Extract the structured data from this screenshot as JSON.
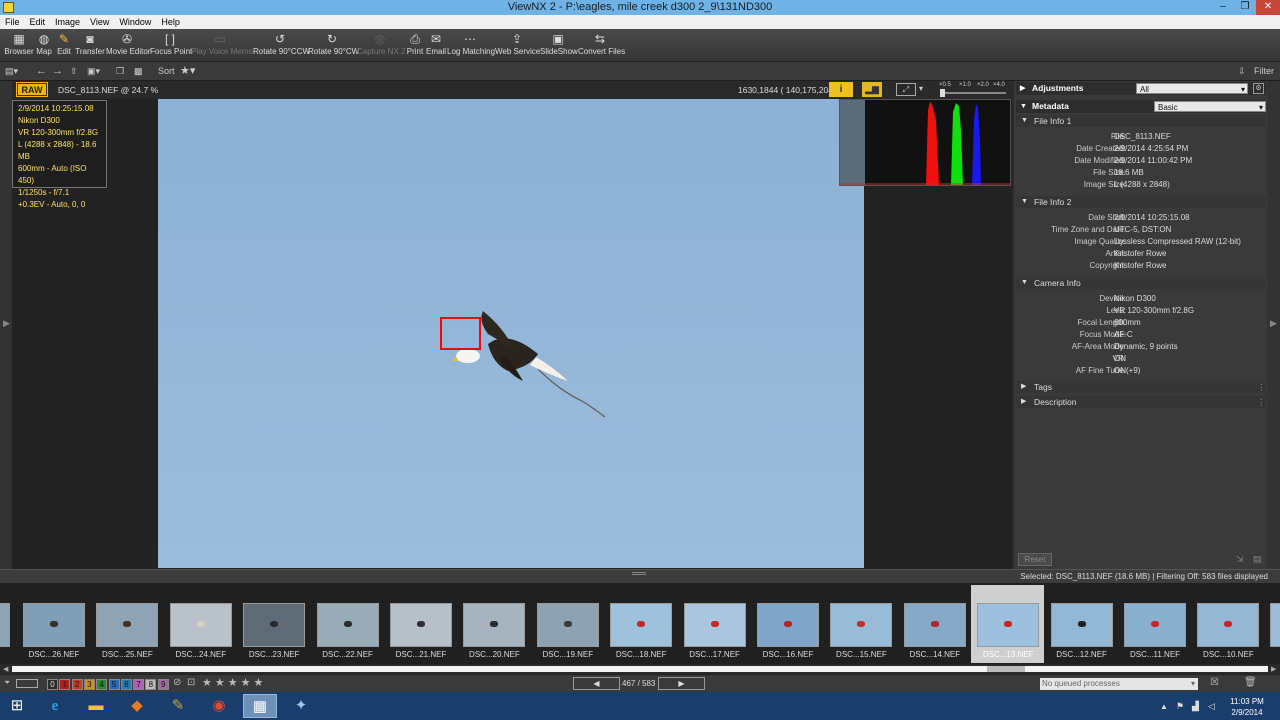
{
  "window": {
    "title": "ViewNX 2 - P:\\eagles, mile creek d300 2_9\\131ND300",
    "min": "–",
    "max": "❐",
    "close": "✕"
  },
  "menu": [
    "File",
    "Edit",
    "Image",
    "View",
    "Window",
    "Help"
  ],
  "toolbar": [
    {
      "label": "Browser",
      "icon": "grid-icon",
      "glyph": "▦",
      "enabled": true
    },
    {
      "label": "Map",
      "icon": "globe-icon",
      "glyph": "◍",
      "enabled": true
    },
    {
      "label": "Edit",
      "icon": "pencil-icon",
      "glyph": "✎",
      "enabled": true
    },
    {
      "label": "Transfer",
      "icon": "camera-icon",
      "glyph": "◙",
      "enabled": true
    },
    {
      "label": "Movie Editor",
      "icon": "film-reel-icon",
      "glyph": "✇",
      "enabled": true
    },
    {
      "label": "Focus Point",
      "icon": "focus-bracket-icon",
      "glyph": "[ ]",
      "enabled": true
    },
    {
      "label": "Play Voice Memo",
      "icon": "speaker-icon",
      "glyph": "▭",
      "enabled": false
    },
    {
      "label": "Rotate 90°CCW",
      "icon": "rotate-ccw-icon",
      "glyph": "↺",
      "enabled": true
    },
    {
      "label": "Rotate 90°CW",
      "icon": "rotate-cw-icon",
      "glyph": "↻",
      "enabled": true
    },
    {
      "label": "Capture NX 2",
      "icon": "capture-nx-icon",
      "glyph": "◎",
      "enabled": false
    },
    {
      "label": "Print",
      "icon": "printer-icon",
      "glyph": "⎙",
      "enabled": true
    },
    {
      "label": "Email",
      "icon": "envelope-icon",
      "glyph": "✉",
      "enabled": true
    },
    {
      "label": "Log Matching",
      "icon": "log-matching-icon",
      "glyph": "⋯",
      "enabled": true
    },
    {
      "label": "Web Service",
      "icon": "web-service-icon",
      "glyph": "⇪",
      "enabled": true
    },
    {
      "label": "SlideShow",
      "icon": "slideshow-icon",
      "glyph": "▣",
      "enabled": true
    },
    {
      "label": "Convert Files",
      "icon": "convert-files-icon",
      "glyph": "⇆",
      "enabled": true
    }
  ],
  "toolbar2": {
    "sort_label": "Sort",
    "filter_label": "Filter"
  },
  "viewer": {
    "badge": "RAW",
    "filename": "DSC_8113.NEF @ 24.7 %",
    "coords": "1630,1844 ( 140,175,204 )",
    "zoom_levels": [
      "×0.5",
      "×1.0",
      "×2.0",
      "×4.0"
    ],
    "exif": [
      "2/9/2014 10:25:15.08",
      "Nikon D300",
      "VR 120-300mm f/2.8G",
      "L (4288 x 2848) - 18.6 MB",
      "600mm - Auto (ISO 450)",
      "1/1250s - f/7.1",
      "+0.3EV - Auto, 0, 0"
    ]
  },
  "right_panel": {
    "adjustments": {
      "title": "Adjustments",
      "select": "All"
    },
    "metadata": {
      "title": "Metadata",
      "select": "Basic"
    },
    "file_info_1": {
      "title": "File Info 1",
      "rows": [
        {
          "k": "File:",
          "v": "DSC_8113.NEF"
        },
        {
          "k": "Date Created:",
          "v": "2/9/2014 4:25:54 PM"
        },
        {
          "k": "Date Modified:",
          "v": "2/9/2014 11:00:42 PM"
        },
        {
          "k": "File Size:",
          "v": "18.6 MB"
        },
        {
          "k": "Image Size:",
          "v": "L (4288 x 2848)"
        }
      ]
    },
    "file_info_2": {
      "title": "File Info 2",
      "rows": [
        {
          "k": "Date Shot:",
          "v": "2/9/2014 10:25:15.08"
        },
        {
          "k": "Time Zone and Date:",
          "v": "UTC-5, DST:ON"
        },
        {
          "k": "Image Quality:",
          "v": "Lossless Compressed RAW (12-bit)"
        },
        {
          "k": "Artist:",
          "v": "Kristofer Rowe"
        },
        {
          "k": "Copyright:",
          "v": "Kristofer Rowe"
        }
      ]
    },
    "camera_info": {
      "title": "Camera Info",
      "rows": [
        {
          "k": "Device:",
          "v": "Nikon D300"
        },
        {
          "k": "Lens:",
          "v": "VR 120-300mm f/2.8G"
        },
        {
          "k": "Focal Length:",
          "v": "600mm"
        },
        {
          "k": "Focus Mode:",
          "v": "AF-C"
        },
        {
          "k": "AF-Area Mode:",
          "v": "Dynamic, 9 points"
        },
        {
          "k": "VR:",
          "v": "ON"
        },
        {
          "k": "AF Fine Tune:",
          "v": "ON(+9)"
        }
      ]
    },
    "tags": "Tags",
    "description": "Description",
    "reset": "Reset"
  },
  "status": "Selected: DSC_8113.NEF (18.6 MB) | Filtering Off: 583 files displayed",
  "filmstrip": [
    "DSC...26.NEF",
    "DSC...25.NEF",
    "DSC...24.NEF",
    "DSC...23.NEF",
    "DSC...22.NEF",
    "DSC...21.NEF",
    "DSC...20.NEF",
    "DSC...19.NEF",
    "DSC...18.NEF",
    "DSC...17.NEF",
    "DSC...16.NEF",
    "DSC...15.NEF",
    "DSC...14.NEF",
    "DSC...13.NEF",
    "DSC...12.NEF",
    "DSC...11.NEF",
    "DSC...10.NEF"
  ],
  "bottom": {
    "labels": [
      "0",
      "1",
      "2",
      "3",
      "4",
      "5",
      "6",
      "7",
      "8",
      "9"
    ],
    "counter": "467 / 583",
    "queue": "No queued processes"
  },
  "taskbar": {
    "time": "11:03 PM",
    "date": "2/9/2014"
  },
  "colors": {
    "accent": "#6fb3e6",
    "raw_badge": "#f2b40d",
    "focus_box": "#e01010",
    "sky": "#92b5d7"
  }
}
